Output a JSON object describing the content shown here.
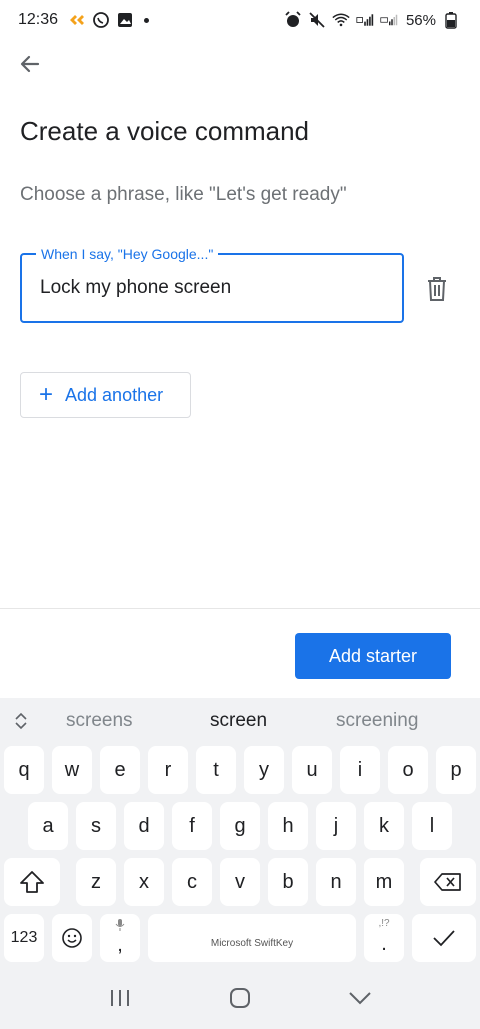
{
  "status": {
    "time": "12:36",
    "battery": "56%"
  },
  "page": {
    "title": "Create a voice command",
    "subtitle": "Choose a phrase, like \"Let's get ready\""
  },
  "field": {
    "label": "When I say, \"Hey Google...\"",
    "value": "Lock my phone screen"
  },
  "buttons": {
    "add_another": "Add another",
    "add_starter": "Add starter"
  },
  "keyboard": {
    "suggestions": [
      "screens",
      "screen",
      "screening"
    ],
    "row1": [
      "q",
      "w",
      "e",
      "r",
      "t",
      "y",
      "u",
      "i",
      "o",
      "p"
    ],
    "row2": [
      "a",
      "s",
      "d",
      "f",
      "g",
      "h",
      "j",
      "k",
      "l"
    ],
    "row3": [
      "z",
      "x",
      "c",
      "v",
      "b",
      "n",
      "m"
    ],
    "num_key": "123",
    "comma_key": ",",
    "period_key": ".",
    "period_sub": ",!?",
    "space_label": "Microsoft SwiftKey"
  },
  "colors": {
    "accent": "#1a73e8",
    "keyboard_bg": "#f1f2f4"
  }
}
